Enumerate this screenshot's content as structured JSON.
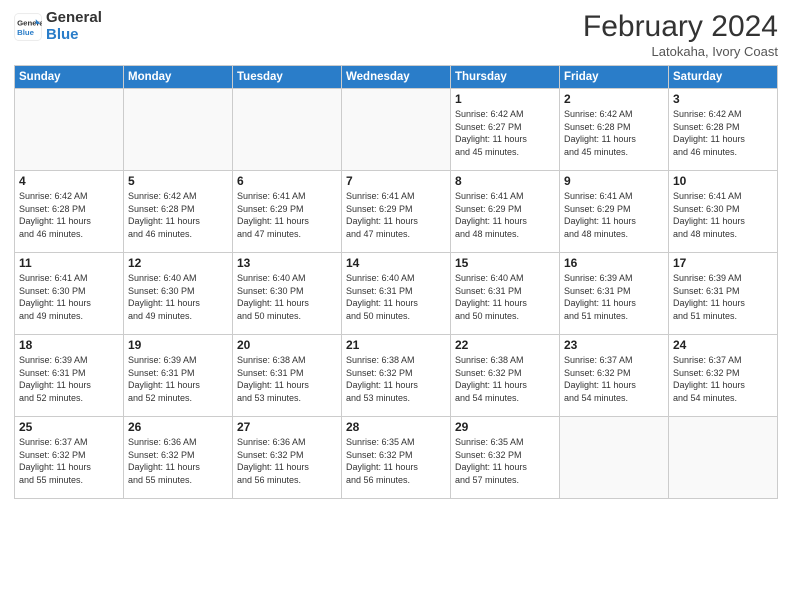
{
  "header": {
    "logo_general": "General",
    "logo_blue": "Blue",
    "month_title": "February 2024",
    "subtitle": "Latokaha, Ivory Coast"
  },
  "days_of_week": [
    "Sunday",
    "Monday",
    "Tuesday",
    "Wednesday",
    "Thursday",
    "Friday",
    "Saturday"
  ],
  "weeks": [
    [
      {
        "day": "",
        "info": ""
      },
      {
        "day": "",
        "info": ""
      },
      {
        "day": "",
        "info": ""
      },
      {
        "day": "",
        "info": ""
      },
      {
        "day": "1",
        "info": "Sunrise: 6:42 AM\nSunset: 6:27 PM\nDaylight: 11 hours\nand 45 minutes."
      },
      {
        "day": "2",
        "info": "Sunrise: 6:42 AM\nSunset: 6:28 PM\nDaylight: 11 hours\nand 45 minutes."
      },
      {
        "day": "3",
        "info": "Sunrise: 6:42 AM\nSunset: 6:28 PM\nDaylight: 11 hours\nand 46 minutes."
      }
    ],
    [
      {
        "day": "4",
        "info": "Sunrise: 6:42 AM\nSunset: 6:28 PM\nDaylight: 11 hours\nand 46 minutes."
      },
      {
        "day": "5",
        "info": "Sunrise: 6:42 AM\nSunset: 6:28 PM\nDaylight: 11 hours\nand 46 minutes."
      },
      {
        "day": "6",
        "info": "Sunrise: 6:41 AM\nSunset: 6:29 PM\nDaylight: 11 hours\nand 47 minutes."
      },
      {
        "day": "7",
        "info": "Sunrise: 6:41 AM\nSunset: 6:29 PM\nDaylight: 11 hours\nand 47 minutes."
      },
      {
        "day": "8",
        "info": "Sunrise: 6:41 AM\nSunset: 6:29 PM\nDaylight: 11 hours\nand 48 minutes."
      },
      {
        "day": "9",
        "info": "Sunrise: 6:41 AM\nSunset: 6:29 PM\nDaylight: 11 hours\nand 48 minutes."
      },
      {
        "day": "10",
        "info": "Sunrise: 6:41 AM\nSunset: 6:30 PM\nDaylight: 11 hours\nand 48 minutes."
      }
    ],
    [
      {
        "day": "11",
        "info": "Sunrise: 6:41 AM\nSunset: 6:30 PM\nDaylight: 11 hours\nand 49 minutes."
      },
      {
        "day": "12",
        "info": "Sunrise: 6:40 AM\nSunset: 6:30 PM\nDaylight: 11 hours\nand 49 minutes."
      },
      {
        "day": "13",
        "info": "Sunrise: 6:40 AM\nSunset: 6:30 PM\nDaylight: 11 hours\nand 50 minutes."
      },
      {
        "day": "14",
        "info": "Sunrise: 6:40 AM\nSunset: 6:31 PM\nDaylight: 11 hours\nand 50 minutes."
      },
      {
        "day": "15",
        "info": "Sunrise: 6:40 AM\nSunset: 6:31 PM\nDaylight: 11 hours\nand 50 minutes."
      },
      {
        "day": "16",
        "info": "Sunrise: 6:39 AM\nSunset: 6:31 PM\nDaylight: 11 hours\nand 51 minutes."
      },
      {
        "day": "17",
        "info": "Sunrise: 6:39 AM\nSunset: 6:31 PM\nDaylight: 11 hours\nand 51 minutes."
      }
    ],
    [
      {
        "day": "18",
        "info": "Sunrise: 6:39 AM\nSunset: 6:31 PM\nDaylight: 11 hours\nand 52 minutes."
      },
      {
        "day": "19",
        "info": "Sunrise: 6:39 AM\nSunset: 6:31 PM\nDaylight: 11 hours\nand 52 minutes."
      },
      {
        "day": "20",
        "info": "Sunrise: 6:38 AM\nSunset: 6:31 PM\nDaylight: 11 hours\nand 53 minutes."
      },
      {
        "day": "21",
        "info": "Sunrise: 6:38 AM\nSunset: 6:32 PM\nDaylight: 11 hours\nand 53 minutes."
      },
      {
        "day": "22",
        "info": "Sunrise: 6:38 AM\nSunset: 6:32 PM\nDaylight: 11 hours\nand 54 minutes."
      },
      {
        "day": "23",
        "info": "Sunrise: 6:37 AM\nSunset: 6:32 PM\nDaylight: 11 hours\nand 54 minutes."
      },
      {
        "day": "24",
        "info": "Sunrise: 6:37 AM\nSunset: 6:32 PM\nDaylight: 11 hours\nand 54 minutes."
      }
    ],
    [
      {
        "day": "25",
        "info": "Sunrise: 6:37 AM\nSunset: 6:32 PM\nDaylight: 11 hours\nand 55 minutes."
      },
      {
        "day": "26",
        "info": "Sunrise: 6:36 AM\nSunset: 6:32 PM\nDaylight: 11 hours\nand 55 minutes."
      },
      {
        "day": "27",
        "info": "Sunrise: 6:36 AM\nSunset: 6:32 PM\nDaylight: 11 hours\nand 56 minutes."
      },
      {
        "day": "28",
        "info": "Sunrise: 6:35 AM\nSunset: 6:32 PM\nDaylight: 11 hours\nand 56 minutes."
      },
      {
        "day": "29",
        "info": "Sunrise: 6:35 AM\nSunset: 6:32 PM\nDaylight: 11 hours\nand 57 minutes."
      },
      {
        "day": "",
        "info": ""
      },
      {
        "day": "",
        "info": ""
      }
    ]
  ]
}
